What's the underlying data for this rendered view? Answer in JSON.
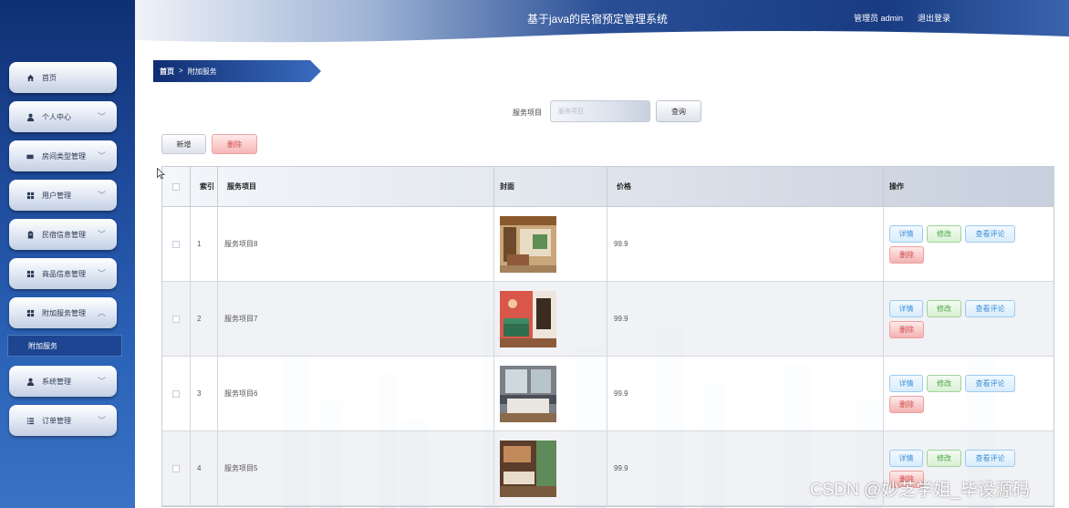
{
  "header": {
    "title": "基于java的民宿预定管理系统",
    "user": "管理员 admin",
    "logout": "退出登录"
  },
  "sidebar": {
    "items": [
      {
        "label": "首页",
        "icon": "home-icon",
        "has_children": false
      },
      {
        "label": "个人中心",
        "icon": "user-icon",
        "has_children": true,
        "expanded": false
      },
      {
        "label": "房间类型管理",
        "icon": "bed-icon",
        "has_children": true,
        "expanded": false
      },
      {
        "label": "用户管理",
        "icon": "grid-icon",
        "has_children": true,
        "expanded": false
      },
      {
        "label": "民宿信息管理",
        "icon": "clipboard-icon",
        "has_children": true,
        "expanded": false
      },
      {
        "label": "商品信息管理",
        "icon": "grid-icon",
        "has_children": true,
        "expanded": false
      },
      {
        "label": "附加服务管理",
        "icon": "grid-icon",
        "has_children": true,
        "expanded": true
      },
      {
        "label": "系统管理",
        "icon": "user-icon",
        "has_children": true,
        "expanded": false
      },
      {
        "label": "订单管理",
        "icon": "list-icon",
        "has_children": true,
        "expanded": false
      }
    ],
    "active_sub": "附加服务"
  },
  "breadcrumb": {
    "home": "首页",
    "separator": ">",
    "current": "附加服务"
  },
  "search": {
    "label": "服务项目",
    "placeholder": "服务项目",
    "button": "查询"
  },
  "actions": {
    "add": "新增",
    "delete": "删除"
  },
  "table": {
    "headers": {
      "index": "索引",
      "name": "服务项目",
      "cover": "封面",
      "price": "价格",
      "ops": "操作"
    },
    "op_labels": {
      "detail": "详情",
      "edit": "修改",
      "comment": "查看评论",
      "delete": "删除"
    },
    "rows": [
      {
        "index": "1",
        "name": "服务项目8",
        "price": "99.9"
      },
      {
        "index": "2",
        "name": "服务项目7",
        "price": "99.9"
      },
      {
        "index": "3",
        "name": "服务项目6",
        "price": "99.9"
      },
      {
        "index": "4",
        "name": "服务项目5",
        "price": "99.9"
      }
    ]
  },
  "watermark": "CSDN @妙芝学姐_毕设源码",
  "colors": {
    "sidebar_top": "#0f2f73",
    "sidebar_bottom": "#3a73c4",
    "header": "#1a3f8a",
    "detail_blue": "#3d8fd8",
    "edit_green": "#4aa443",
    "delete_red": "#d24a4a"
  }
}
